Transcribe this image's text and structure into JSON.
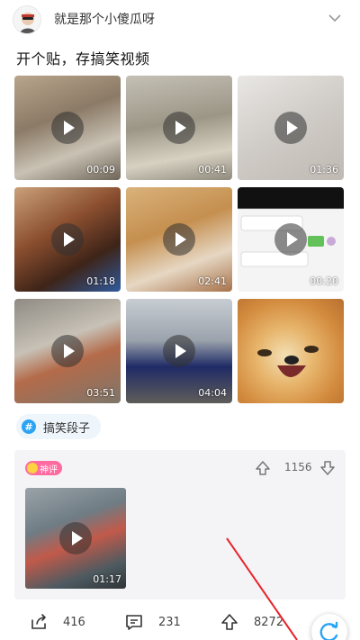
{
  "post": {
    "author": "就是那个小傻瓜呀",
    "title": "开个贴，存搞笑视频"
  },
  "videos": [
    {
      "duration": "00:09",
      "bg": "linear-gradient(160deg,#b9a58c 0%,#8b7a66 40%,#c9c2b4 70%,#6e6558 100%)"
    },
    {
      "duration": "00:41",
      "bg": "linear-gradient(170deg,#c4c0b5 0%,#9c9686 45%,#d7d1c2 75%,#8f8a7d 100%)"
    },
    {
      "duration": "01:36",
      "bg": "linear-gradient(150deg,#e9e7e4 0%,#cfcbc6 50%,#bfb9b2 100%)"
    },
    {
      "duration": "01:18",
      "bg": "linear-gradient(150deg,#caa07a 0%,#8a4e2f 40%,#3e2418 70%,#2f5a9e 100%)"
    },
    {
      "duration": "02:41",
      "bg": "linear-gradient(160deg,#d9b27b 0%,#c58f4f 40%,#e6d7c3 70%,#a6724a 100%)"
    },
    {
      "duration": "00:20",
      "bg": "linear-gradient(180deg,#111111 0%,#111111 20%,#f4f4f4 21%,#f4f4f4 100%)"
    },
    {
      "duration": "03:51",
      "bg": "linear-gradient(160deg,#8f8b84 0%,#c7c1b6 40%,#b46b4a 60%,#7d766b 100%)"
    },
    {
      "duration": "04:04",
      "bg": "linear-gradient(180deg,#c8cdd3 0%,#9aa2ab 40%,#1f2b66 65%,#5f5d59 100%)"
    },
    {
      "duration": "",
      "bg": "radial-gradient(circle at 45% 55%,#f3e0b6 0%,#e7b56c 35%,#d28a3d 70%,#b87030 100%)"
    }
  ],
  "topic": {
    "label": "搞笑段子",
    "icon": "#"
  },
  "comment": {
    "badge": "神评",
    "votes": "1156",
    "video_duration": "01:17",
    "video_bg": "linear-gradient(160deg,#9aa3a8 0%,#6f7c84 35%,#c15a4a 55%,#4d5a60 80%,#2f3538 100%)"
  },
  "actions": {
    "share_count": "416",
    "comment_count": "231",
    "like_count": "8272"
  },
  "colors": {
    "topic_accent": "#2aa4f4",
    "badge_bg": "#ff6aa0",
    "annotation_line": "#e8232a",
    "refresh_accent": "#2aa4f4"
  }
}
